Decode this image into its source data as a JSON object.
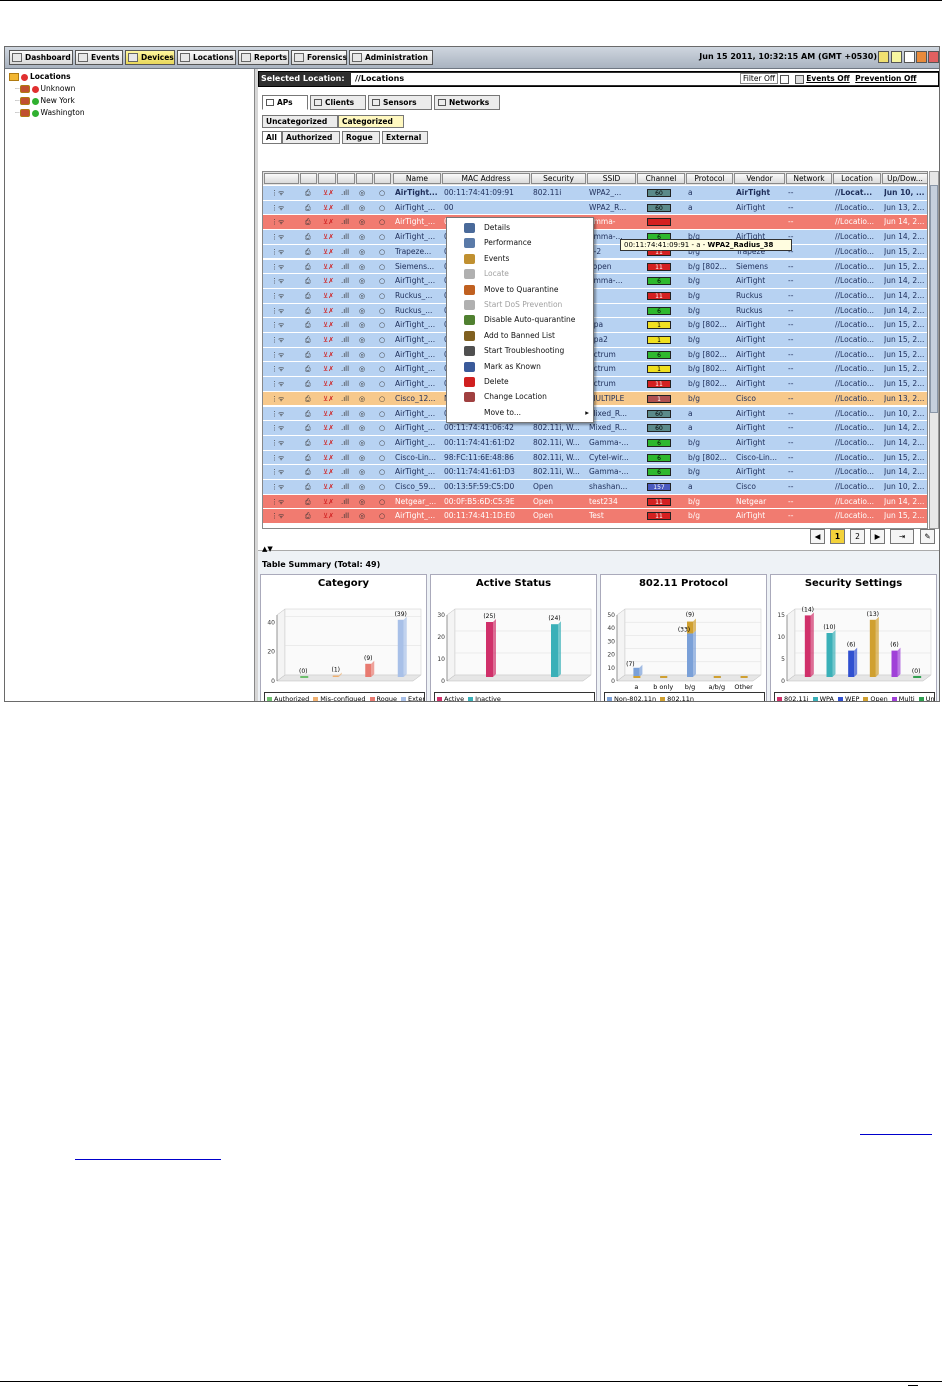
{
  "nav": {
    "buttons": [
      "Dashboard",
      "Events",
      "Devices",
      "Locations",
      "Reports",
      "Forensics",
      "Administration"
    ],
    "active": "Devices",
    "datetime": "Jun 15 2011, 10:32:15 AM (GMT +0530)"
  },
  "tree": {
    "root": "Locations",
    "children": [
      "Unknown",
      "New York",
      "Washington"
    ]
  },
  "location_bar": {
    "label": "Selected Location:",
    "value": "//Locations",
    "filter": "Filter Off",
    "events": "Events Off",
    "prevention": "Prevention Off"
  },
  "tabs": [
    "APs",
    "Clients",
    "Sensors",
    "Networks"
  ],
  "subtabs1": [
    "Uncategorized",
    "Categorized"
  ],
  "subtabs2": [
    "All",
    "Authorized",
    "Rogue",
    "External"
  ],
  "columns": [
    "Name",
    "MAC Address",
    "Security",
    "SSID",
    "Channel",
    "Protocol",
    "Vendor",
    "Network",
    "Location",
    "Up/Dow..."
  ],
  "rows": [
    {
      "c": "blue",
      "name": "AirTight...",
      "mac": "00:11:74:41:09:91",
      "sec": "802.11i",
      "ssid": "WPA2_...",
      "ch": "60",
      "chc": "#5b8a8a",
      "proto": "a",
      "vendor": "AirTight",
      "net": "--",
      "loc": "//Locat...",
      "up": "Jun 10, ...",
      "bold": true
    },
    {
      "c": "blue",
      "name": "AirTight_...",
      "mac": "00",
      "sec": "",
      "ssid": "WPA2_R...",
      "ch": "60",
      "chc": "#5b8a8a",
      "proto": "a",
      "vendor": "AirTight",
      "net": "--",
      "loc": "//Locatio...",
      "up": "Jun 13, 2..."
    },
    {
      "c": "red",
      "name": "AirTight_...",
      "mac": "00",
      "sec": "",
      "ssid": "amma-",
      "ch": "",
      "chc": "#d42020",
      "proto": "",
      "vendor": "",
      "net": "--",
      "loc": "//Locatio...",
      "up": "Jun 14, 2..."
    },
    {
      "c": "blue",
      "name": "AirTight_...",
      "mac": "00",
      "sec": "",
      "ssid": "amma-...",
      "ch": "6",
      "chc": "#2eb82e",
      "proto": "b/g",
      "vendor": "AirTight",
      "net": "--",
      "loc": "//Locatio...",
      "up": "Jun 14, 2..."
    },
    {
      "c": "blue",
      "name": "Trapeze...",
      "mac": "00",
      "sec": "",
      "ssid": "e-2",
      "ch": "11",
      "chc": "#d42020",
      "proto": "b/g",
      "vendor": "Trapeze",
      "net": "--",
      "loc": "//Locatio...",
      "up": "Jun 15, 2..."
    },
    {
      "c": "blue",
      "name": "Siemens...",
      "mac": "00",
      "sec": "",
      "ssid": "_open",
      "ch": "11",
      "chc": "#d42020",
      "proto": "b/g [802...",
      "vendor": "Siemens",
      "net": "--",
      "loc": "//Locatio...",
      "up": "Jun 15, 2..."
    },
    {
      "c": "blue",
      "name": "AirTight_...",
      "mac": "00",
      "sec": "",
      "ssid": "amma-...",
      "ch": "6",
      "chc": "#2eb82e",
      "proto": "b/g",
      "vendor": "AirTight",
      "net": "--",
      "loc": "//Locatio...",
      "up": "Jun 14, 2..."
    },
    {
      "c": "blue",
      "name": "Ruckus_...",
      "mac": "04",
      "sec": "",
      "ssid": "",
      "ch": "11",
      "chc": "#d42020",
      "proto": "b/g",
      "vendor": "Ruckus",
      "net": "--",
      "loc": "//Locatio...",
      "up": "Jun 14, 2..."
    },
    {
      "c": "blue",
      "name": "Ruckus_...",
      "mac": "00",
      "sec": "",
      "ssid": "",
      "ch": "6",
      "chc": "#2eb82e",
      "proto": "b/g",
      "vendor": "Ruckus",
      "net": "--",
      "loc": "//Locatio...",
      "up": "Jun 14, 2..."
    },
    {
      "c": "blue",
      "name": "AirTight_...",
      "mac": "00",
      "sec": "",
      "ssid": "ppa",
      "ch": "1",
      "chc": "#f0e020",
      "proto": "b/g [802...",
      "vendor": "AirTight",
      "net": "--",
      "loc": "//Locatio...",
      "up": "Jun 15, 2..."
    },
    {
      "c": "blue",
      "name": "AirTight_...",
      "mac": "00",
      "sec": "",
      "ssid": "ppa2",
      "ch": "1",
      "chc": "#f0e020",
      "proto": "b/g",
      "vendor": "AirTight",
      "net": "--",
      "loc": "//Locatio...",
      "up": "Jun 15, 2..."
    },
    {
      "c": "blue",
      "name": "AirTight_...",
      "mac": "00",
      "sec": "",
      "ssid": "ectrum",
      "ch": "6",
      "chc": "#2eb82e",
      "proto": "b/g [802...",
      "vendor": "AirTight",
      "net": "--",
      "loc": "//Locatio...",
      "up": "Jun 15, 2..."
    },
    {
      "c": "blue",
      "name": "AirTight_...",
      "mac": "00",
      "sec": "",
      "ssid": "ectrum",
      "ch": "1",
      "chc": "#f0e020",
      "proto": "b/g [802...",
      "vendor": "AirTight",
      "net": "--",
      "loc": "//Locatio...",
      "up": "Jun 15, 2..."
    },
    {
      "c": "blue",
      "name": "AirTight_...",
      "mac": "00",
      "sec": "",
      "ssid": "ectrum",
      "ch": "11",
      "chc": "#d42020",
      "proto": "b/g [802...",
      "vendor": "AirTight",
      "net": "--",
      "loc": "//Locatio...",
      "up": "Jun 15, 2..."
    },
    {
      "c": "orange",
      "name": "Cisco_12...",
      "mac": "MULTIPLE",
      "sec": "MULTIPLE",
      "ssid": "MULTIPLE",
      "ch": "1",
      "chc": "#b05050",
      "proto": "b/g",
      "vendor": "Cisco",
      "net": "--",
      "loc": "//Locatio...",
      "up": "Jun 13, 2..."
    },
    {
      "c": "blue",
      "name": "AirTight_...",
      "mac": "00:11:74:41:09:92",
      "sec": "802.11i, W...",
      "ssid": "Mixed_R...",
      "ch": "60",
      "chc": "#5b8a8a",
      "proto": "a",
      "vendor": "AirTight",
      "net": "--",
      "loc": "//Locatio...",
      "up": "Jun 10, 2..."
    },
    {
      "c": "blue",
      "name": "AirTight_...",
      "mac": "00:11:74:41:06:42",
      "sec": "802.11i, W...",
      "ssid": "Mixed_R...",
      "ch": "60",
      "chc": "#5b8a8a",
      "proto": "a",
      "vendor": "AirTight",
      "net": "--",
      "loc": "//Locatio...",
      "up": "Jun 14, 2..."
    },
    {
      "c": "blue",
      "name": "AirTight_...",
      "mac": "00:11:74:41:61:D2",
      "sec": "802.11i, W...",
      "ssid": "Gamma-...",
      "ch": "6",
      "chc": "#2eb82e",
      "proto": "b/g",
      "vendor": "AirTight",
      "net": "--",
      "loc": "//Locatio...",
      "up": "Jun 14, 2..."
    },
    {
      "c": "blue",
      "name": "Cisco-Lin...",
      "mac": "98:FC:11:6E:48:86",
      "sec": "802.11i, W...",
      "ssid": "Cytel-wir...",
      "ch": "6",
      "chc": "#2eb82e",
      "proto": "b/g [802...",
      "vendor": "Cisco-Lin...",
      "net": "--",
      "loc": "//Locatio...",
      "up": "Jun 15, 2..."
    },
    {
      "c": "blue",
      "name": "AirTight_...",
      "mac": "00:11:74:41:61:D3",
      "sec": "802.11i, W...",
      "ssid": "Gamma-...",
      "ch": "6",
      "chc": "#2eb82e",
      "proto": "b/g",
      "vendor": "AirTight",
      "net": "--",
      "loc": "//Locatio...",
      "up": "Jun 14, 2..."
    },
    {
      "c": "blue",
      "name": "Cisco_59...",
      "mac": "00:13:5F:59:C5:D0",
      "sec": "Open",
      "ssid": "shashan...",
      "ch": "157",
      "chc": "#4a5ac0",
      "proto": "a",
      "vendor": "Cisco",
      "net": "--",
      "loc": "//Locatio...",
      "up": "Jun 10, 2..."
    },
    {
      "c": "red",
      "name": "Netgear_...",
      "mac": "00:0F:B5:6D:C5:9E",
      "sec": "Open",
      "ssid": "test234",
      "ch": "11",
      "chc": "#d42020",
      "proto": "b/g",
      "vendor": "Netgear",
      "net": "--",
      "loc": "//Locatio...",
      "up": "Jun 14, 2..."
    },
    {
      "c": "red",
      "name": "AirTight_...",
      "mac": "00:11:74:41:1D:E0",
      "sec": "Open",
      "ssid": "Test",
      "ch": "11",
      "chc": "#d42020",
      "proto": "b/g",
      "vendor": "AirTight",
      "net": "--",
      "loc": "//Locatio...",
      "up": "Jun 15, 2..."
    }
  ],
  "context_menu": [
    {
      "label": "Details",
      "enabled": true,
      "icon": "details-icon",
      "color": "#4a6a9a"
    },
    {
      "label": "Performance",
      "enabled": true,
      "icon": "performance-icon",
      "color": "#5a7aa8"
    },
    {
      "label": "Events",
      "enabled": true,
      "icon": "events-icon",
      "color": "#c09030"
    },
    {
      "label": "Locate",
      "enabled": false,
      "icon": "locate-icon",
      "color": "#b0b0b0"
    },
    {
      "label": "Move to Quarantine",
      "enabled": true,
      "icon": "quarantine-icon",
      "color": "#c06020"
    },
    {
      "label": "Start DoS Prevention",
      "enabled": false,
      "icon": "dos-prevention-icon",
      "color": "#b0b0b0"
    },
    {
      "label": "Disable Auto-quarantine",
      "enabled": true,
      "icon": "auto-quarantine-icon",
      "color": "#508030"
    },
    {
      "label": "Add to Banned List",
      "enabled": true,
      "icon": "banned-list-icon",
      "color": "#806020"
    },
    {
      "label": "Start Troubleshooting",
      "enabled": true,
      "icon": "troubleshoot-icon",
      "color": "#505050"
    },
    {
      "label": "Mark as Known",
      "enabled": true,
      "icon": "mark-known-icon",
      "color": "#3a5a9a"
    },
    {
      "label": "Delete",
      "enabled": true,
      "icon": "delete-icon",
      "color": "#d02020"
    },
    {
      "label": "Change Location",
      "enabled": true,
      "icon": "change-location-icon",
      "color": "#a04040"
    },
    {
      "label": "Move to...",
      "enabled": true,
      "icon": "",
      "color": ""
    }
  ],
  "tooltip": {
    "prefix": "00:11:74:41:09:91 - a - ",
    "ssid": "WPA2_Radius_38"
  },
  "pager": {
    "pages": [
      "1",
      "2"
    ],
    "current": "1"
  },
  "summary": {
    "title": "Table Summary (Total: 49)"
  },
  "chart_data": [
    {
      "type": "bar",
      "title": "Category",
      "ylim": [
        0,
        45
      ],
      "yticks": [
        "0",
        "20",
        "40"
      ],
      "series": [
        {
          "name": "Authorized",
          "value": 0,
          "label": "(0)",
          "color": "#6fbf6f"
        },
        {
          "name": "Mis-configued",
          "value": 1,
          "label": "(1)",
          "color": "#f0b070"
        },
        {
          "name": "Rogue",
          "value": 9,
          "label": "(9)",
          "color": "#e87a70"
        },
        {
          "name": "External",
          "value": 39,
          "label": "(39)",
          "color": "#a8c0e8"
        }
      ]
    },
    {
      "type": "bar",
      "title": "Active Status",
      "ylim": [
        0,
        30
      ],
      "yticks": [
        "0",
        "10",
        "20",
        "30"
      ],
      "series": [
        {
          "name": "Active",
          "value": 25,
          "label": "(25)",
          "color": "#d0306a"
        },
        {
          "name": "Inactive",
          "value": 24,
          "label": "(24)",
          "color": "#3ab0b8"
        }
      ]
    },
    {
      "type": "bar",
      "title": "802.11 Protocol",
      "ylim": [
        0,
        50
      ],
      "yticks": [
        "0",
        "10",
        "20",
        "30",
        "40",
        "50"
      ],
      "categories": [
        "a",
        "b only",
        "b/g",
        "a/b/g",
        "Other"
      ],
      "series": [
        {
          "name": "Non-802.11n",
          "values": [
            7,
            0,
            33,
            0,
            0
          ],
          "color": "#7aa0d8"
        },
        {
          "name": "802.11n",
          "values": [
            0,
            0,
            9,
            0,
            0
          ],
          "color": "#d0a030"
        }
      ],
      "labels": [
        "(7)",
        "",
        "(33)",
        "",
        ""
      ],
      "top_labels": [
        "",
        "",
        "(9)",
        "",
        ""
      ]
    },
    {
      "type": "bar",
      "title": "Security Settings",
      "ylim": [
        0,
        15
      ],
      "yticks": [
        "0",
        "5",
        "10",
        "15"
      ],
      "series": [
        {
          "name": "802.11i",
          "value": 14,
          "label": "(14)",
          "color": "#d0306a"
        },
        {
          "name": "WPA",
          "value": 10,
          "label": "(10)",
          "color": "#3ab0b8"
        },
        {
          "name": "WEP",
          "value": 6,
          "label": "(6)",
          "color": "#3050d0"
        },
        {
          "name": "Open",
          "value": 13,
          "label": "(13)",
          "color": "#d0a030"
        },
        {
          "name": "Multi",
          "value": 6,
          "label": "(6)",
          "color": "#a040d8"
        },
        {
          "name": "Unknown",
          "value": 0,
          "label": "(0)",
          "color": "#30a050"
        }
      ]
    }
  ],
  "bottom_link": {
    "line1": "",
    "line2": ""
  }
}
